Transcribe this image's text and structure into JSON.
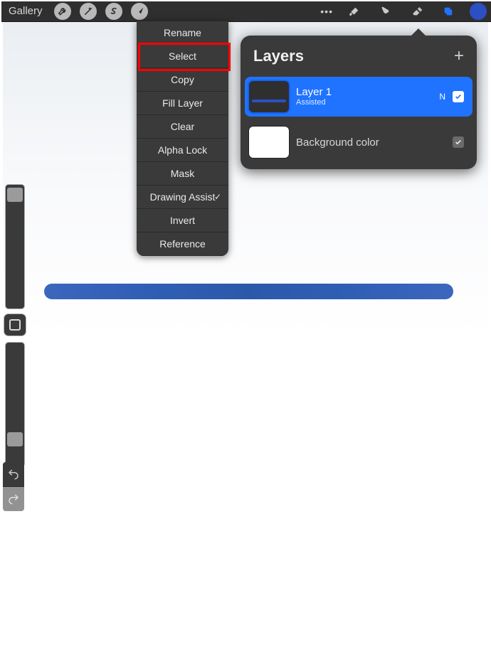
{
  "topbar": {
    "gallery_label": "Gallery"
  },
  "context_menu": {
    "items": [
      {
        "label": "Rename",
        "checked": false
      },
      {
        "label": "Select",
        "checked": false
      },
      {
        "label": "Copy",
        "checked": false
      },
      {
        "label": "Fill Layer",
        "checked": false
      },
      {
        "label": "Clear",
        "checked": false
      },
      {
        "label": "Alpha Lock",
        "checked": false
      },
      {
        "label": "Mask",
        "checked": false
      },
      {
        "label": "Drawing Assist",
        "checked": true
      },
      {
        "label": "Invert",
        "checked": false
      },
      {
        "label": "Reference",
        "checked": false
      }
    ],
    "highlighted_index": 1
  },
  "layers_panel": {
    "title": "Layers",
    "rows": [
      {
        "name": "Layer 1",
        "subtitle": "Assisted",
        "blend": "N",
        "checked": true,
        "selected": true
      },
      {
        "name": "Background color",
        "subtitle": "",
        "blend": "",
        "checked": true,
        "selected": false
      }
    ]
  },
  "sidebar": {
    "brush_size_percent": 92,
    "opacity_percent": 10
  },
  "colors": {
    "accent_blue": "#1f73ff",
    "stroke_blue": "#2f5fb5",
    "swatch": "#2d4fc4",
    "highlight_red": "#ff0000"
  }
}
